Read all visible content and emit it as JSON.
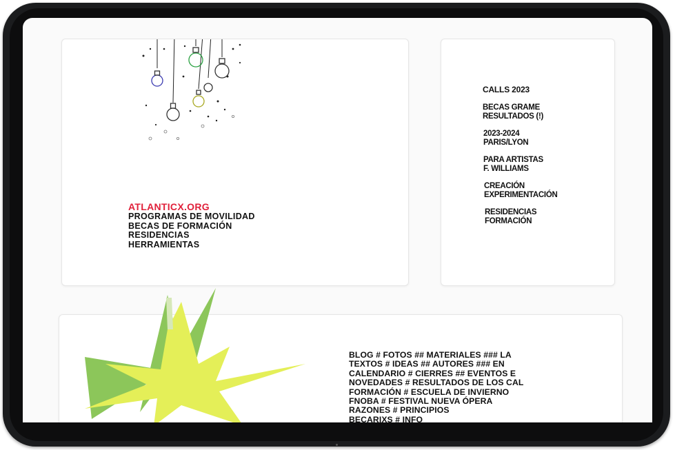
{
  "intro": {
    "site": "ATLANTICX.ORG",
    "lines": [
      "PROGRAMAS DE MOVILIDAD",
      "BECAS DE FORMACIÓN",
      "RESIDENCIAS",
      "HERRAMIENTAS"
    ]
  },
  "calls": {
    "title": "CALLS 2023",
    "items": [
      [
        "BECAS GRAME",
        "RESULTADOS (!)"
      ],
      [
        "2023-2024",
        "PARIS/LYON"
      ],
      [
        "PARA ARTISTAS",
        "F. WILLIAMS"
      ],
      [
        "CREACIÓN",
        "EXPERIMENTACIÓN"
      ],
      [
        "RESIDENCIAS",
        "FORMACIÓN"
      ]
    ]
  },
  "tags": [
    "BLOG  # FOTOS ## MATERIALES ### LA",
    "TEXTOS  # IDEAS ## AUTORES ### EN",
    "CALENDARIO  # CIERRES ## EVENTOS E",
    "NOVEDADES # RESULTADOS DE LOS CAL",
    "FORMACIÓN # ESCUELA DE INVIERNO",
    "FNOBA # FESTIVAL NUEVA ÓPERA",
    "RAZONES # PRINCIPIOS",
    "BECARIXS # INFO"
  ],
  "colors": {
    "accent": "#e0203a",
    "star_yellow": "#e4ef58",
    "star_green": "#8cc65a",
    "frame": "#1b1c1e"
  }
}
